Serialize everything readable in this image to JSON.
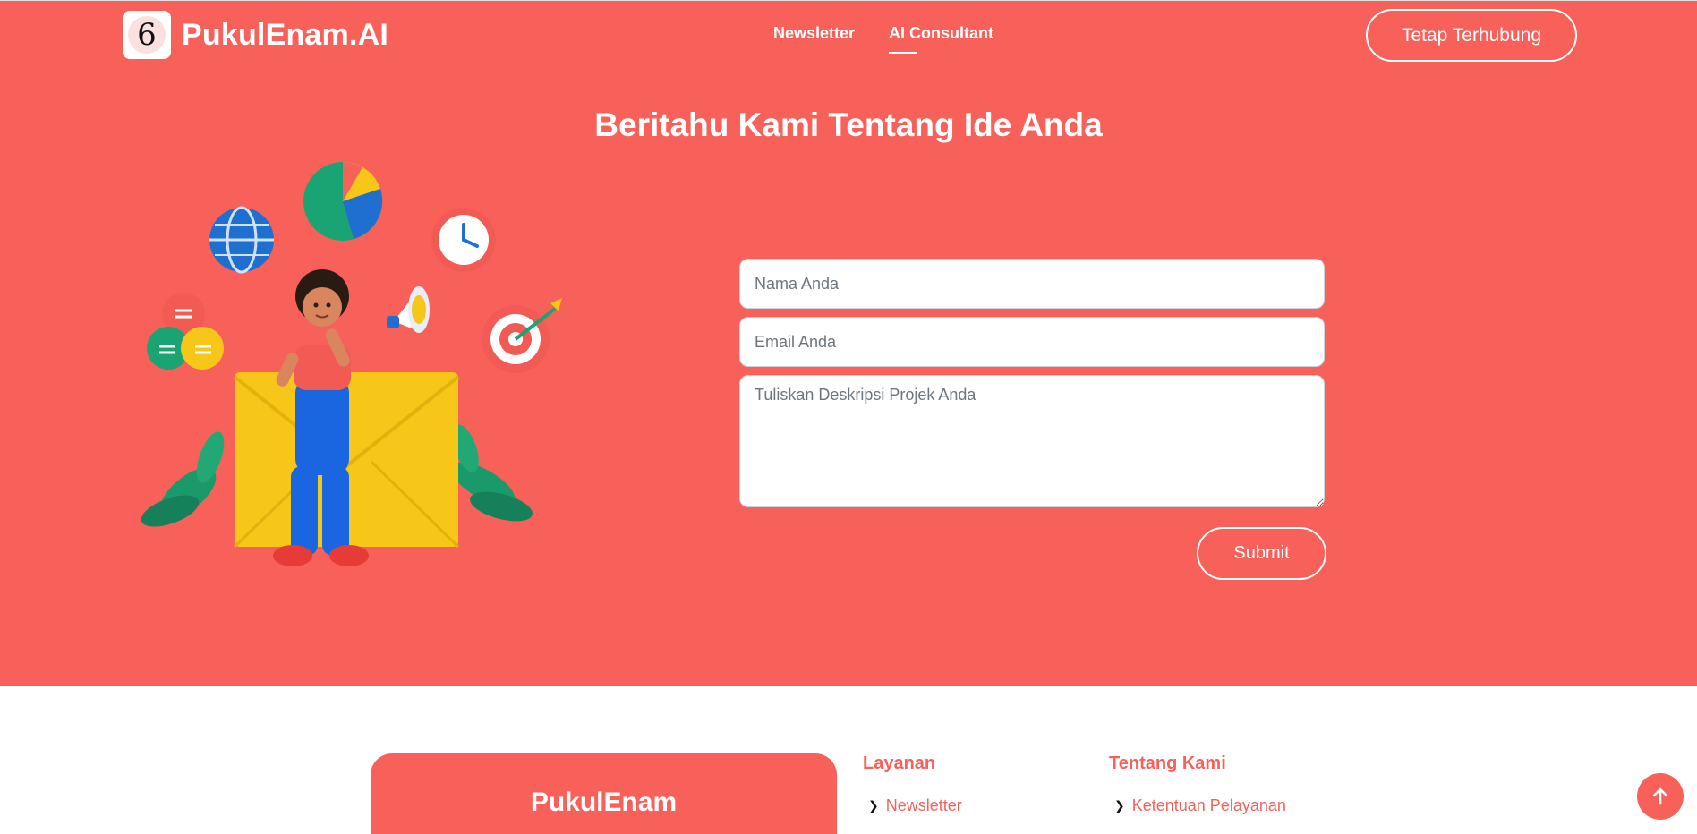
{
  "header": {
    "brand": "PukulEnam.AI",
    "logo_glyph": "6",
    "nav": [
      {
        "label": "Newsletter",
        "active": false
      },
      {
        "label": "AI Consultant",
        "active": true
      }
    ],
    "cta_label": "Tetap Terhubung"
  },
  "main": {
    "title": "Beritahu Kami Tentang Ide Anda",
    "form": {
      "name_placeholder": "Nama Anda",
      "name_value": "",
      "email_placeholder": "Email Anda",
      "email_value": "",
      "description_placeholder": "Tuliskan Deskripsi Projek Anda",
      "description_value": "",
      "submit_label": "Submit"
    }
  },
  "footer": {
    "brand": "PukulEnam",
    "columns": [
      {
        "title": "Layanan",
        "links": [
          "Newsletter"
        ]
      },
      {
        "title": "Tentang Kami",
        "links": [
          "Ketentuan Pelayanan"
        ]
      }
    ]
  },
  "colors": {
    "accent": "#f8615a",
    "text_on_accent": "#ffffff"
  },
  "icons": {
    "scroll_top": "arrow-up-icon",
    "link_bullet": "chevron-right-icon"
  }
}
